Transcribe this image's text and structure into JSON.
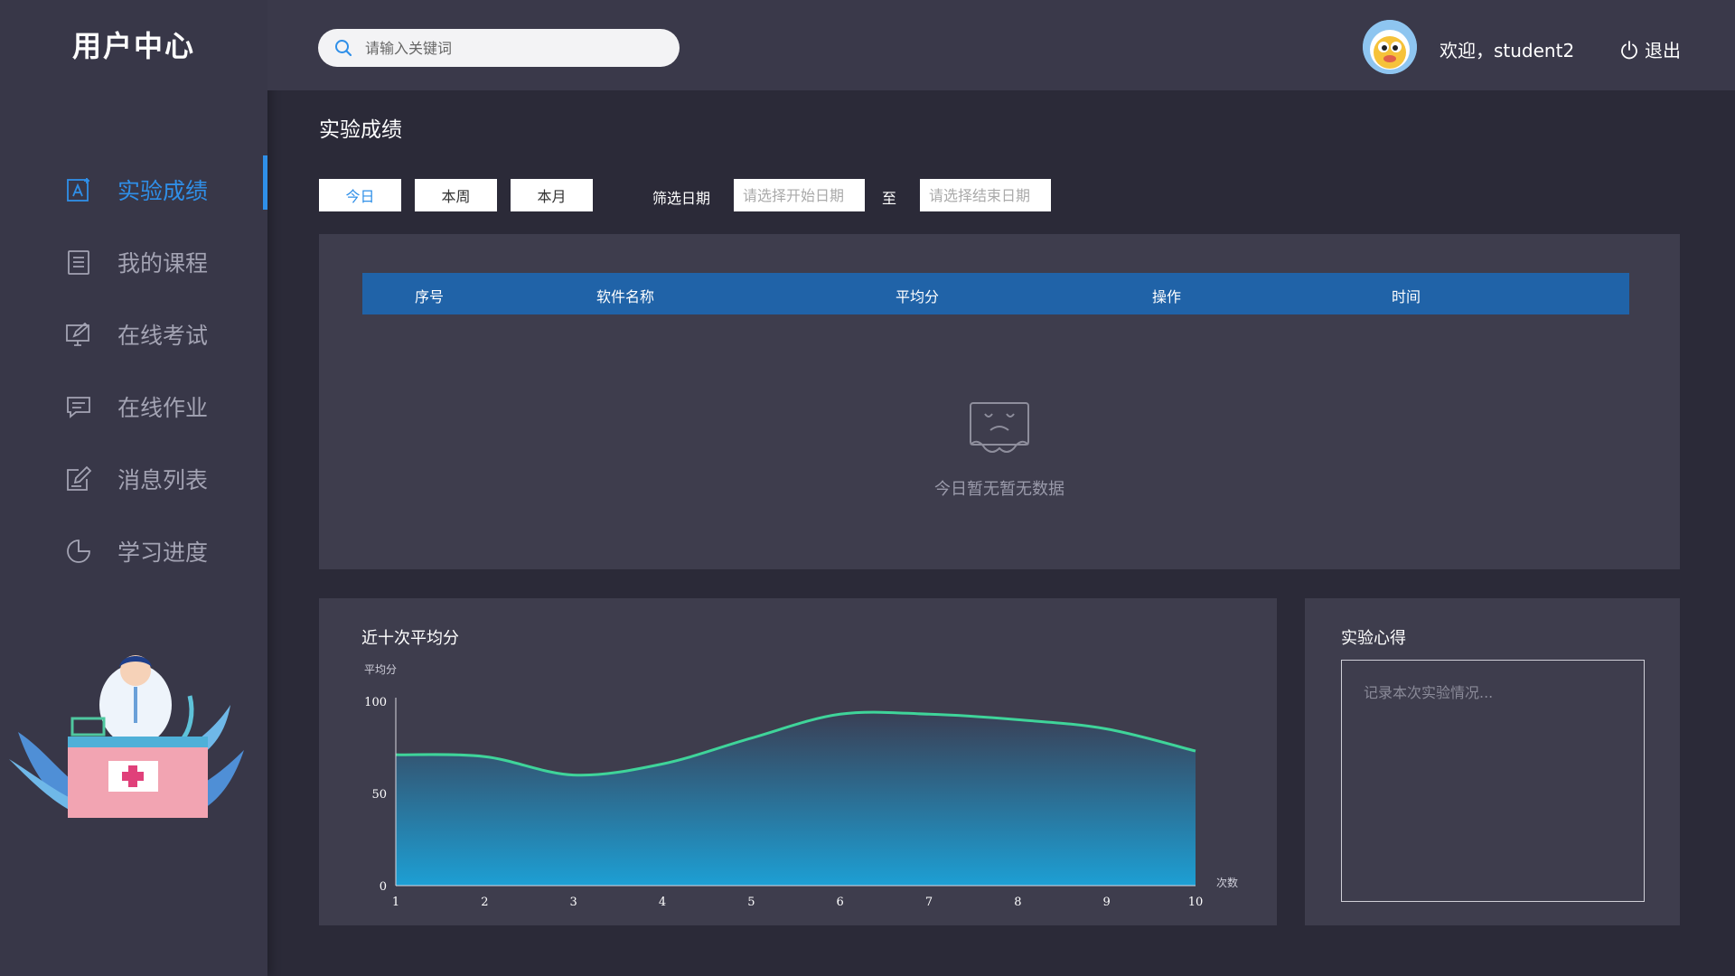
{
  "app": {
    "title": "用户中心"
  },
  "sidebar": {
    "items": [
      {
        "label": "实验成绩",
        "icon": "experiment-score-icon",
        "active": true
      },
      {
        "label": "我的课程",
        "icon": "document-list-icon",
        "active": false
      },
      {
        "label": "在线考试",
        "icon": "monitor-edit-icon",
        "active": false
      },
      {
        "label": "在线作业",
        "icon": "chat-bubble-icon",
        "active": false
      },
      {
        "label": "消息列表",
        "icon": "edit-note-icon",
        "active": false
      },
      {
        "label": "学习进度",
        "icon": "pie-chart-icon",
        "active": false
      }
    ]
  },
  "header": {
    "search_placeholder": "请输入关键词",
    "welcome": "欢迎，student2",
    "logout": "退出"
  },
  "main": {
    "title": "实验成绩",
    "filters": {
      "today": "今日",
      "week": "本周",
      "month": "本月"
    },
    "date_filter": {
      "label": "筛选日期",
      "start_placeholder": "请选择开始日期",
      "separator": "至",
      "end_placeholder": "请选择结束日期"
    },
    "table": {
      "headers": [
        "序号",
        "软件名称",
        "平均分",
        "操作",
        "时间"
      ],
      "empty_text": "今日暂无暂无数据"
    }
  },
  "chart_panel": {
    "title": "近十次平均分"
  },
  "chart_data": {
    "type": "area",
    "title": "近十次平均分",
    "ylabel": "平均分",
    "xlabel": "次数",
    "x": [
      1,
      2,
      3,
      4,
      5,
      6,
      7,
      8,
      9,
      10
    ],
    "values": [
      71,
      70,
      60,
      66,
      80,
      93,
      93,
      90,
      85,
      73
    ],
    "ylim": [
      0,
      100
    ],
    "yticks": [
      0,
      50,
      100
    ],
    "line_color": "#3fd49a",
    "fill_top_color": "#3a3f55",
    "fill_bottom_color": "#1d9fd4"
  },
  "notes": {
    "title": "实验心得",
    "placeholder": "记录本次实验情况..."
  },
  "colors": {
    "accent": "#2f8fe8",
    "table_header": "#2063a8"
  }
}
